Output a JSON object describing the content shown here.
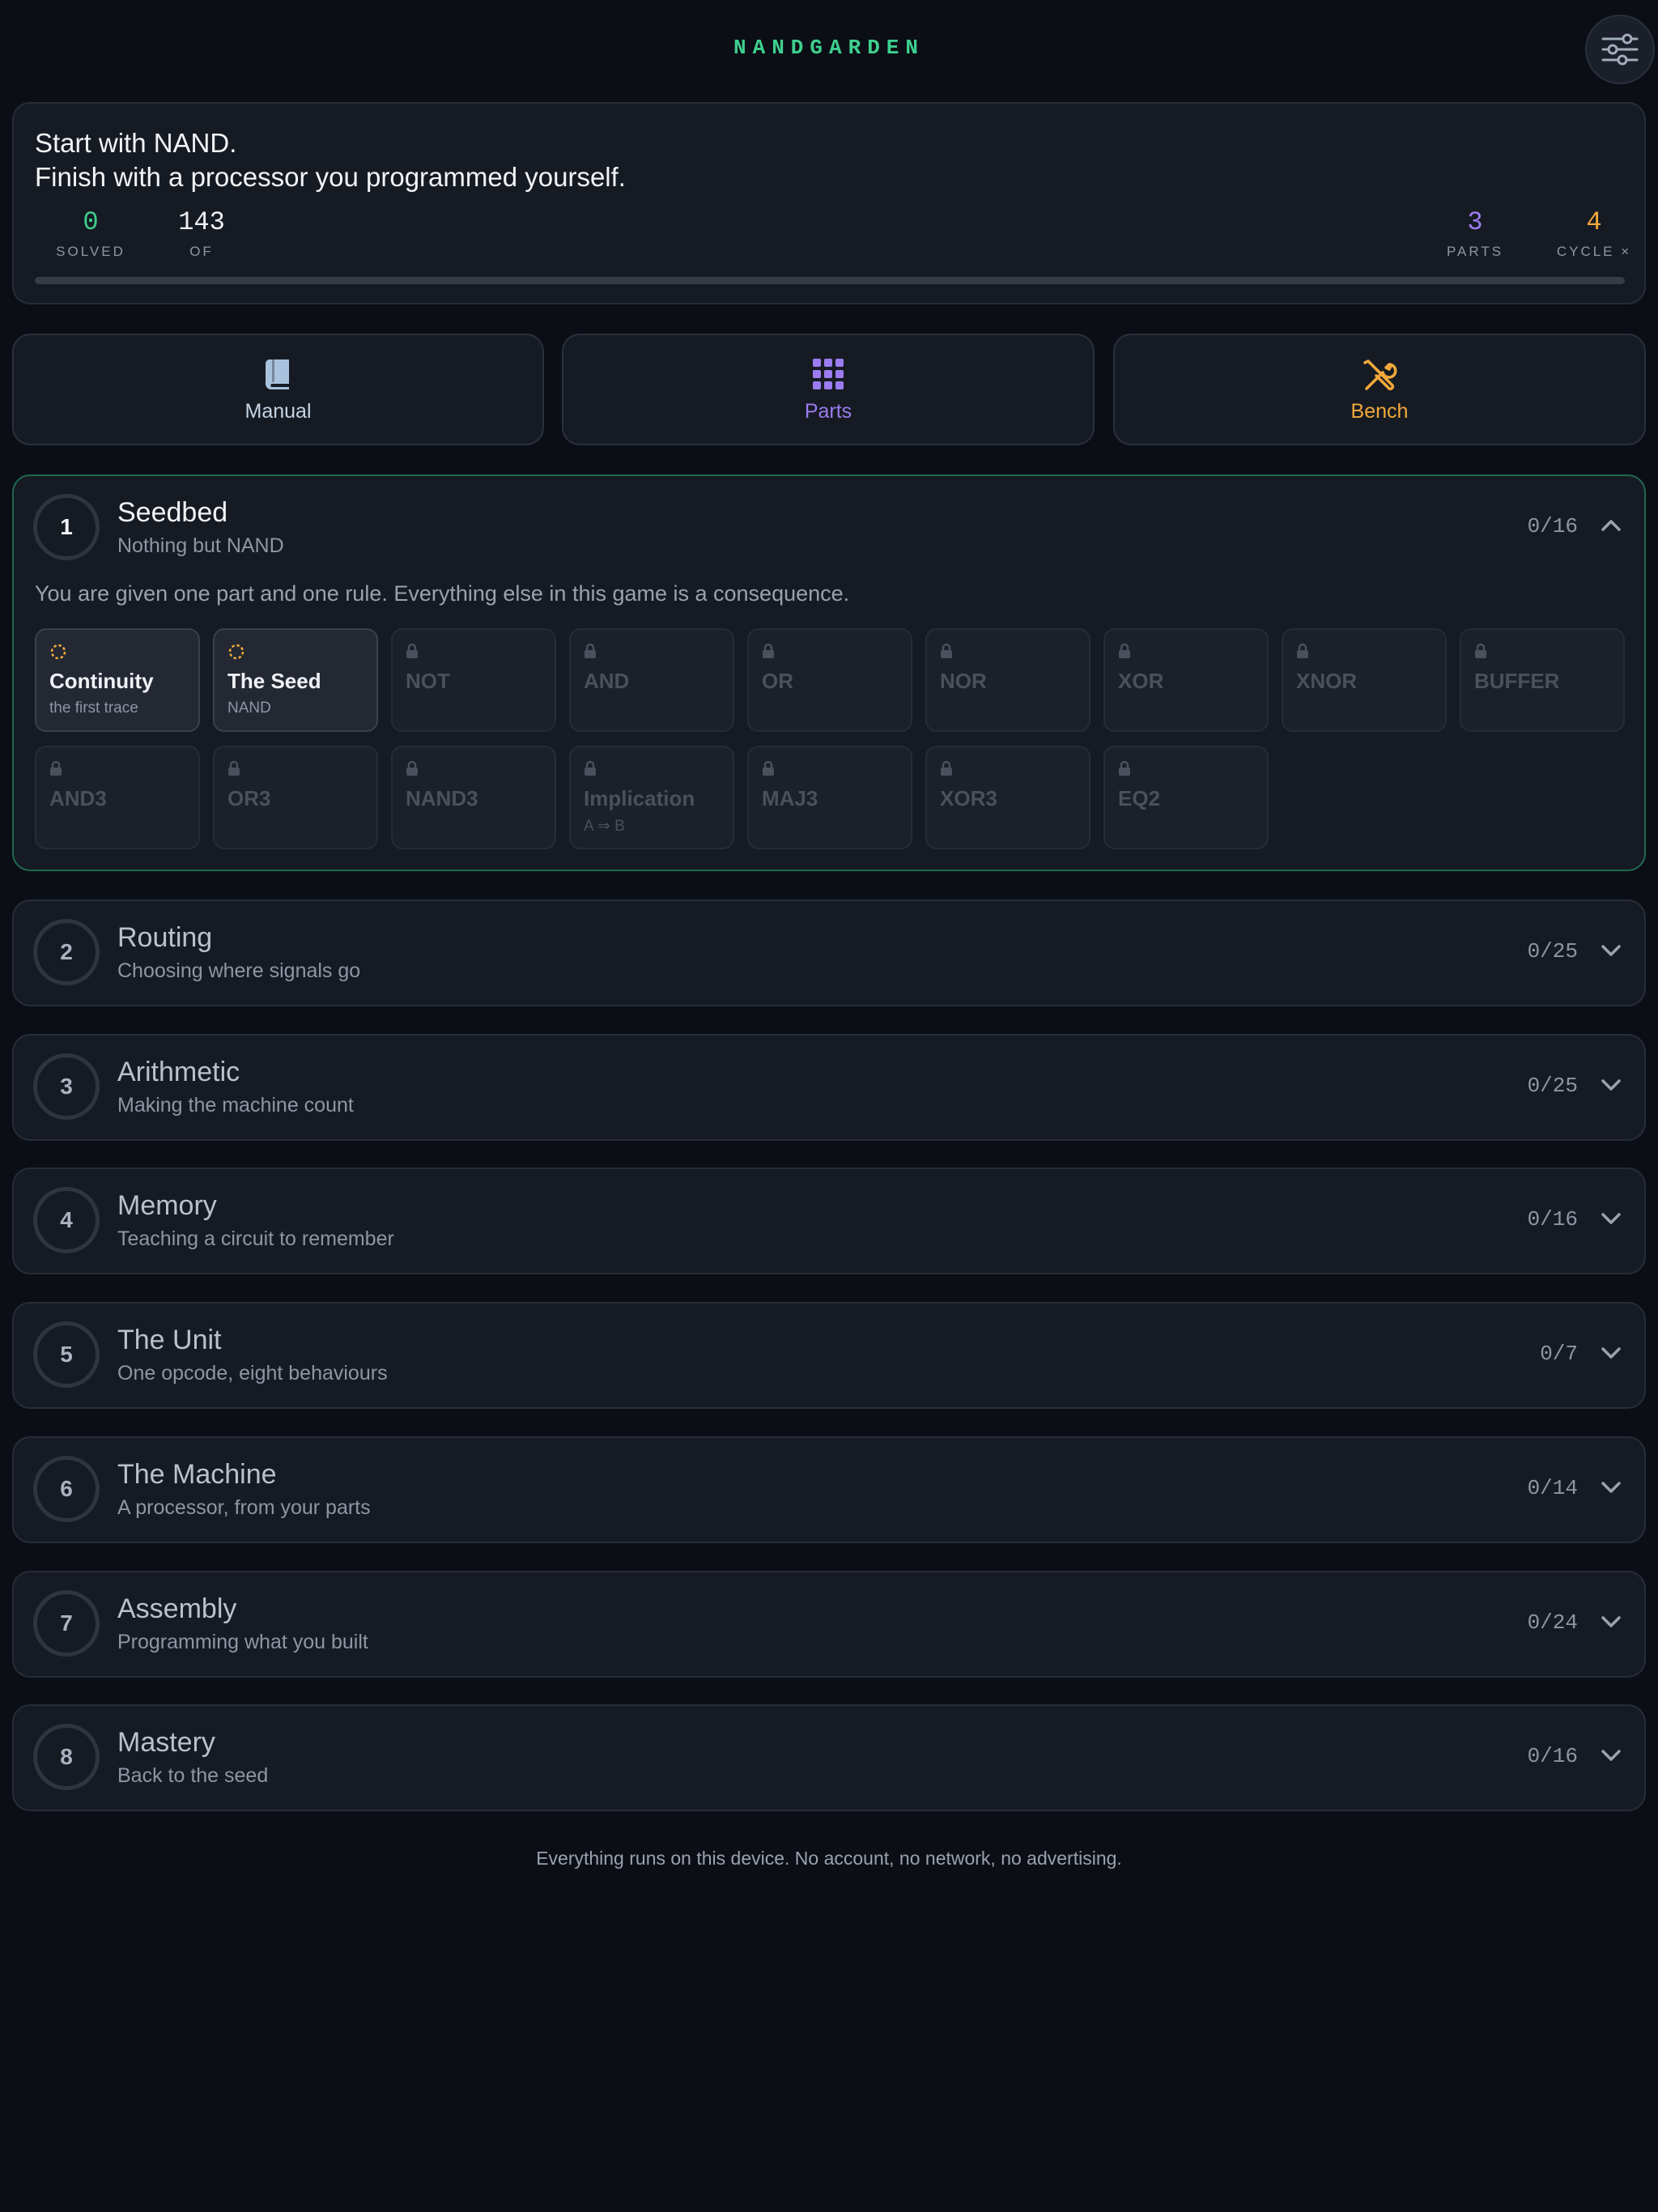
{
  "header": {
    "brand": "NANDGARDEN"
  },
  "hero": {
    "line1": "Start with NAND.",
    "line2": "Finish with a processor you programmed yourself.",
    "stats": {
      "solved": {
        "value": "0",
        "label": "SOLVED"
      },
      "of": {
        "value": "143",
        "label": "OF"
      },
      "parts": {
        "value": "3",
        "label": "PARTS"
      },
      "cycle": {
        "value": "4",
        "label": "CYCLE ×"
      }
    },
    "progress_fraction": 0
  },
  "nav": {
    "manual": "Manual",
    "parts": "Parts",
    "bench": "Bench"
  },
  "colors": {
    "accent_green": "#3fcf8e",
    "accent_purple": "#9b7cf0",
    "accent_orange": "#f2a93b",
    "manual_blue": "#a9c2de"
  },
  "chapters": [
    {
      "number": "1",
      "title": "Seedbed",
      "subtitle": "Nothing but NAND",
      "count": "0/16",
      "expanded": true,
      "description": "You are given one part and one rule. Everything else in this game is a consequence.",
      "puzzles": [
        {
          "name": "Continuity",
          "sub": "the first trace",
          "state": "available"
        },
        {
          "name": "The Seed",
          "sub": "NAND",
          "state": "available"
        },
        {
          "name": "NOT",
          "sub": "",
          "state": "locked"
        },
        {
          "name": "AND",
          "sub": "",
          "state": "locked"
        },
        {
          "name": "OR",
          "sub": "",
          "state": "locked"
        },
        {
          "name": "NOR",
          "sub": "",
          "state": "locked"
        },
        {
          "name": "XOR",
          "sub": "",
          "state": "locked"
        },
        {
          "name": "XNOR",
          "sub": "",
          "state": "locked"
        },
        {
          "name": "BUFFER",
          "sub": "",
          "state": "locked"
        },
        {
          "name": "AND3",
          "sub": "",
          "state": "locked"
        },
        {
          "name": "OR3",
          "sub": "",
          "state": "locked"
        },
        {
          "name": "NAND3",
          "sub": "",
          "state": "locked"
        },
        {
          "name": "Implication",
          "sub": "A ⇒ B",
          "state": "locked"
        },
        {
          "name": "MAJ3",
          "sub": "",
          "state": "locked"
        },
        {
          "name": "XOR3",
          "sub": "",
          "state": "locked"
        },
        {
          "name": "EQ2",
          "sub": "",
          "state": "locked"
        }
      ]
    },
    {
      "number": "2",
      "title": "Routing",
      "subtitle": "Choosing where signals go",
      "count": "0/25",
      "expanded": false
    },
    {
      "number": "3",
      "title": "Arithmetic",
      "subtitle": "Making the machine count",
      "count": "0/25",
      "expanded": false
    },
    {
      "number": "4",
      "title": "Memory",
      "subtitle": "Teaching a circuit to remember",
      "count": "0/16",
      "expanded": false
    },
    {
      "number": "5",
      "title": "The Unit",
      "subtitle": "One opcode, eight behaviours",
      "count": "0/7",
      "expanded": false
    },
    {
      "number": "6",
      "title": "The Machine",
      "subtitle": "A processor, from your parts",
      "count": "0/14",
      "expanded": false
    },
    {
      "number": "7",
      "title": "Assembly",
      "subtitle": "Programming what you built",
      "count": "0/24",
      "expanded": false
    },
    {
      "number": "8",
      "title": "Mastery",
      "subtitle": "Back to the seed",
      "count": "0/16",
      "expanded": false
    }
  ],
  "footer": "Everything runs on this device. No account, no network, no advertising."
}
